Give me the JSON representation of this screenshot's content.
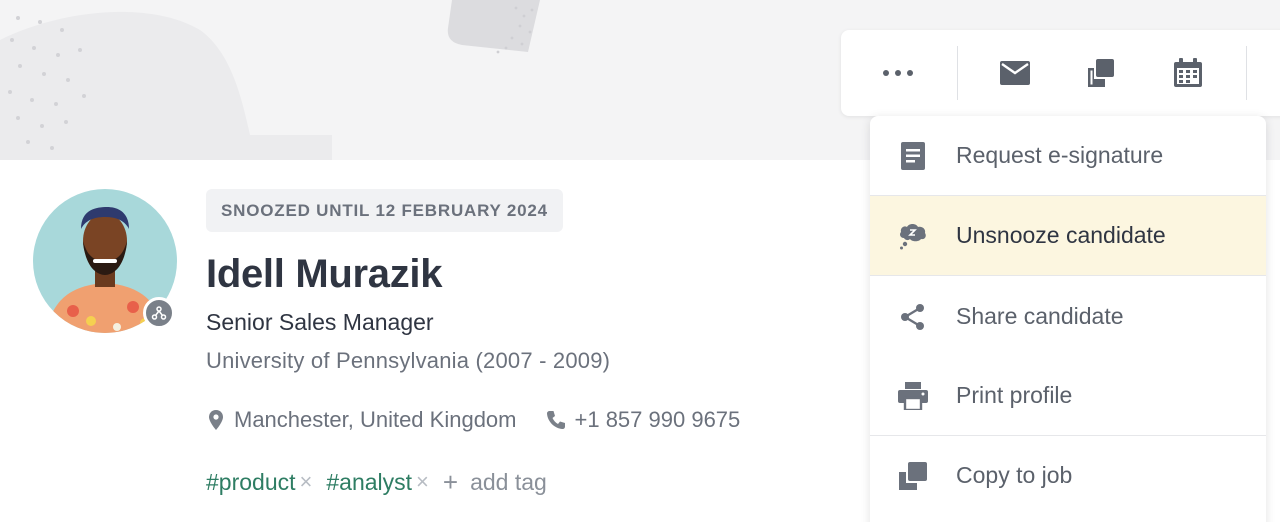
{
  "profile": {
    "status_badge": "SNOOZED UNTIL 12 FEBRUARY 2024",
    "name": "Idell Murazik",
    "title": "Senior Sales Manager",
    "education": "University of Pennsylvania (2007 - 2009)",
    "location": "Manchester, United Kingdom",
    "phone": "+1 857 990 9675"
  },
  "tags": {
    "items": [
      "#product",
      "#analyst"
    ],
    "remove_glyph": "×",
    "add_plus": "+",
    "add_label": "add tag"
  },
  "toolbar": {
    "buttons": [
      {
        "icon": "more-icon"
      },
      {
        "icon": "email-icon"
      },
      {
        "icon": "copy-icon"
      },
      {
        "icon": "calendar-icon"
      }
    ]
  },
  "menu": {
    "items": [
      {
        "label": "Request e-signature",
        "icon": "document-icon"
      },
      {
        "label": "Unsnooze candidate",
        "icon": "snooze-icon",
        "highlighted": true
      },
      {
        "label": "Share candidate",
        "icon": "share-icon"
      },
      {
        "label": "Print profile",
        "icon": "print-icon"
      },
      {
        "label": "Copy to job",
        "icon": "copy-to-job-icon"
      }
    ]
  },
  "colors": {
    "tag": "#2e7d63",
    "highlight": "#fcf6e0",
    "icon": "#6b717c",
    "banner": "#f4f4f5"
  }
}
